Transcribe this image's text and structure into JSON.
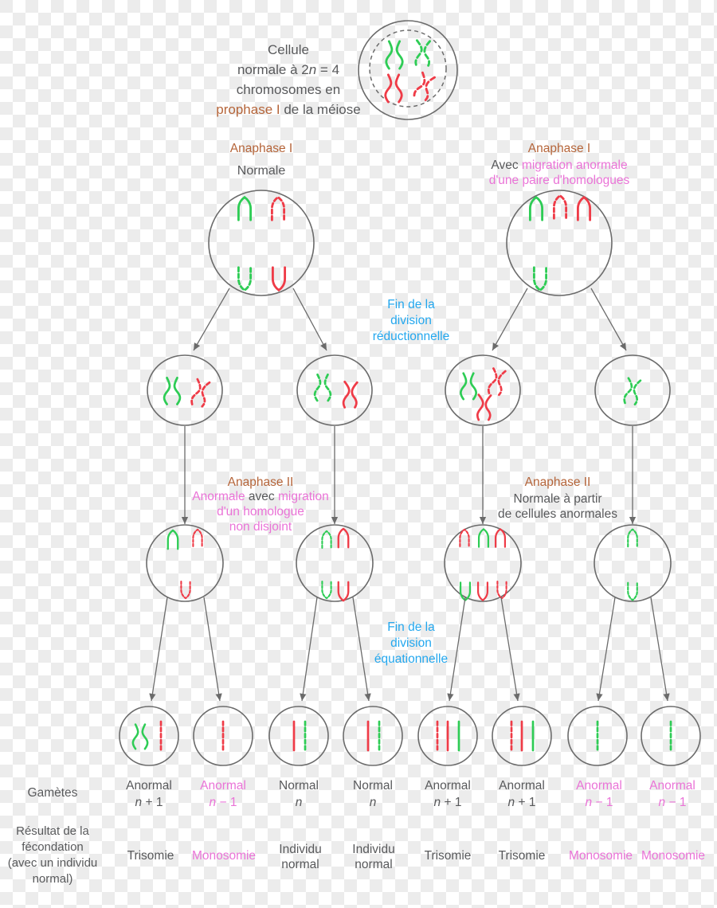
{
  "diagram": {
    "title_intro": {
      "line1": "Cellule",
      "line2_a": "normale à 2",
      "line2_n": "n",
      "line2_b": " = 4",
      "line3": "chromosomes en",
      "line4_a": "prophase I",
      "line4_b": " de la méiose"
    },
    "anaphase1_left": {
      "heading": "Anaphase I",
      "sub": "Normale"
    },
    "anaphase1_right": {
      "heading": "Anaphase I",
      "sub_a": "Avec ",
      "sub_b": "migration anormale",
      "sub_c": "d'une paire d'homologues"
    },
    "reductional": {
      "line1": "Fin de la",
      "line2": "division",
      "line3": "réductionnelle"
    },
    "anaphase2_left": {
      "heading": "Anaphase II",
      "line1_a": "Anormale",
      "line1_b": " avec ",
      "line1_c": "migration",
      "line2": "d'un homologue",
      "line3": "non disjoint"
    },
    "anaphase2_right": {
      "heading": "Anaphase II",
      "line1": "Normale à partir",
      "line2": "de cellules anormales"
    },
    "equational": {
      "line1": "Fin de la",
      "line2": "division",
      "line3": "équationnelle"
    },
    "row_labels": {
      "gametes": "Gamètes",
      "fertilization_l1": "Résultat de la",
      "fertilization_l2": "fécondation",
      "fertilization_l3": "(avec un individu",
      "fertilization_l4": "normal)"
    },
    "gametes": [
      {
        "status": "Anormal",
        "ploidy_n": "n",
        "ploidy_op": " + 1",
        "color": "grey",
        "result_l1": "Trisomie",
        "result_l2": "",
        "result_color": "grey"
      },
      {
        "status": "Anormal",
        "ploidy_n": "n",
        "ploidy_op": " − 1",
        "color": "pink",
        "result_l1": "Monosomie",
        "result_l2": "",
        "result_color": "pink"
      },
      {
        "status": "Normal",
        "ploidy_n": "n",
        "ploidy_op": "",
        "color": "grey",
        "result_l1": "Individu",
        "result_l2": "normal",
        "result_color": "grey"
      },
      {
        "status": "Normal",
        "ploidy_n": "n",
        "ploidy_op": "",
        "color": "grey",
        "result_l1": "Individu",
        "result_l2": "normal",
        "result_color": "grey"
      },
      {
        "status": "Anormal",
        "ploidy_n": "n",
        "ploidy_op": " + 1",
        "color": "grey",
        "result_l1": "Trisomie",
        "result_l2": "",
        "result_color": "grey"
      },
      {
        "status": "Anormal",
        "ploidy_n": "n",
        "ploidy_op": " + 1",
        "color": "grey",
        "result_l1": "Trisomie",
        "result_l2": "",
        "result_color": "grey"
      },
      {
        "status": "Anormal",
        "ploidy_n": "n",
        "ploidy_op": " − 1",
        "color": "pink",
        "result_l1": "Monosomie",
        "result_l2": "",
        "result_color": "pink"
      },
      {
        "status": "Anormal",
        "ploidy_n": "n",
        "ploidy_op": " − 1",
        "color": "pink",
        "result_l1": "Monosomie",
        "result_l2": "",
        "result_color": "pink"
      }
    ],
    "colors": {
      "chromosome_green": "#2ecc55",
      "chromosome_red": "#ef3b47",
      "cell_outline": "#6b6b6b",
      "text_grey": "#58595b",
      "text_orange": "#b5653a",
      "text_pink": "#ea73d7",
      "text_blue": "#23a7ee"
    }
  }
}
